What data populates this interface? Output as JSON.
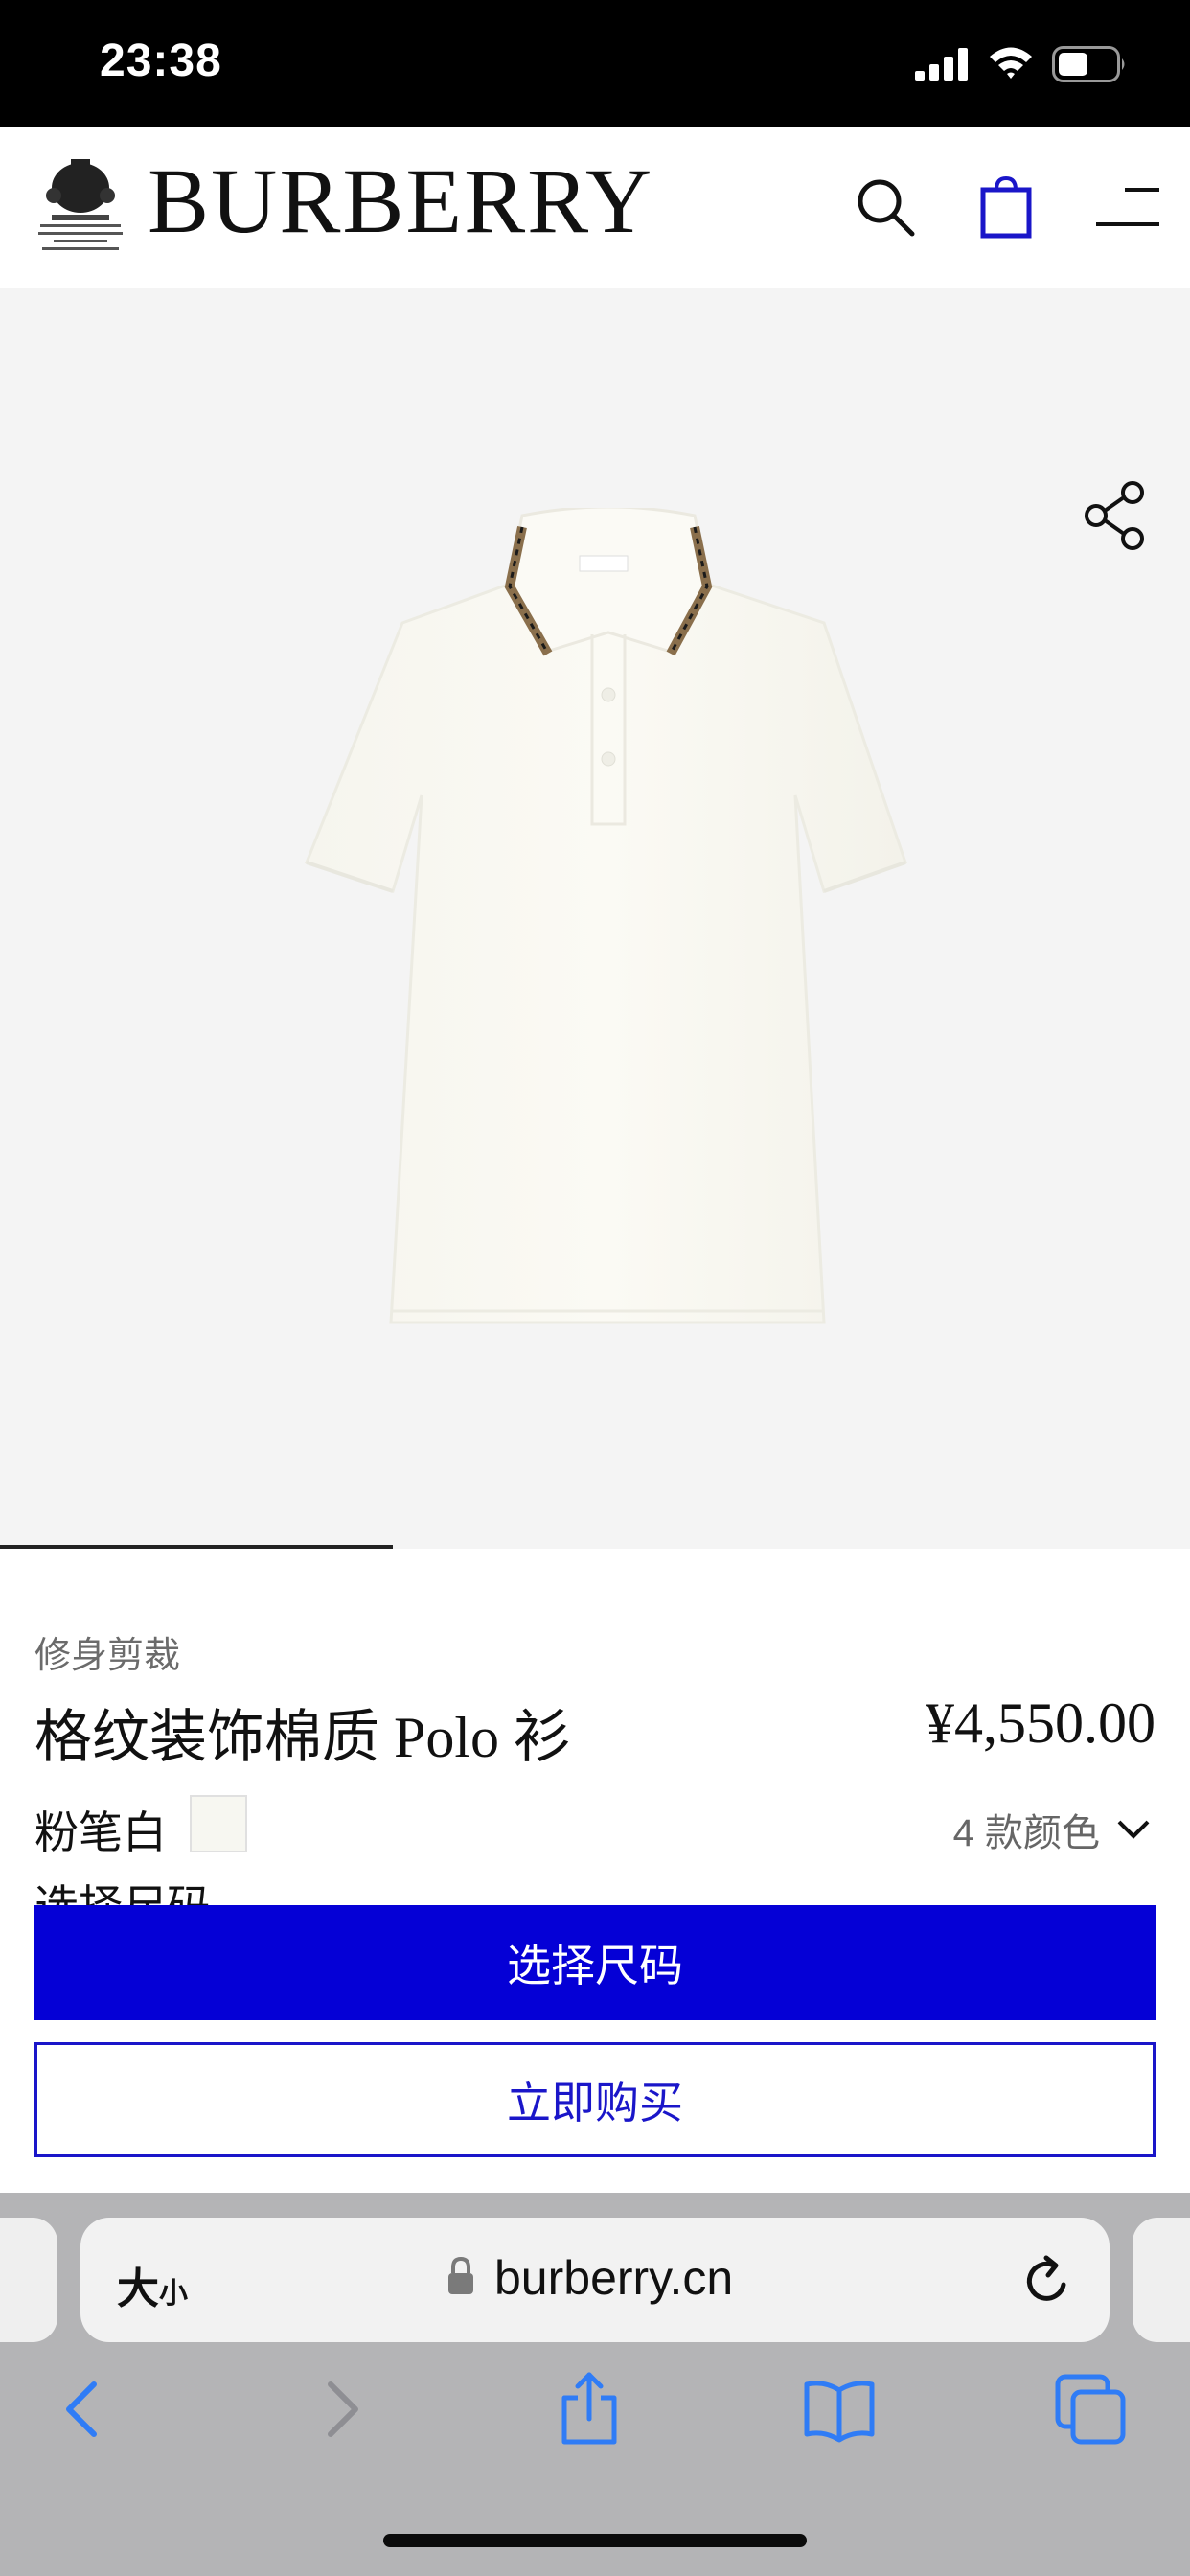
{
  "status_bar": {
    "time": "23:38"
  },
  "header": {
    "crest_lines": [
      "BY APPOINTMENT TO",
      "HIS MAJESTY KING CHARLES III",
      "OUTFITTERS",
      "BURBERRY LIMITED LONDON"
    ],
    "brand": "BURBERRY"
  },
  "product": {
    "fit": "修身剪裁",
    "title": "格纹装饰棉质 Polo 衫",
    "price": "¥4,550.00",
    "color_name": "粉笔白",
    "color_swatch": "#f7f7f1",
    "color_count": "4 款颜色",
    "size_section_label": "选择尺码",
    "image_label": "BURBERRY",
    "gallery_progress": 0.33
  },
  "actions": {
    "select_size": "选择尺码",
    "buy_now": "立即购买"
  },
  "browser": {
    "text_size_big": "大",
    "text_size_small": "小",
    "url": "burberry.cn"
  },
  "colors": {
    "accent": "#0500d6",
    "buy_now_text": "#1a16c9",
    "bag_icon": "#1a16c9",
    "safari_blue": "#2f7cf6"
  }
}
